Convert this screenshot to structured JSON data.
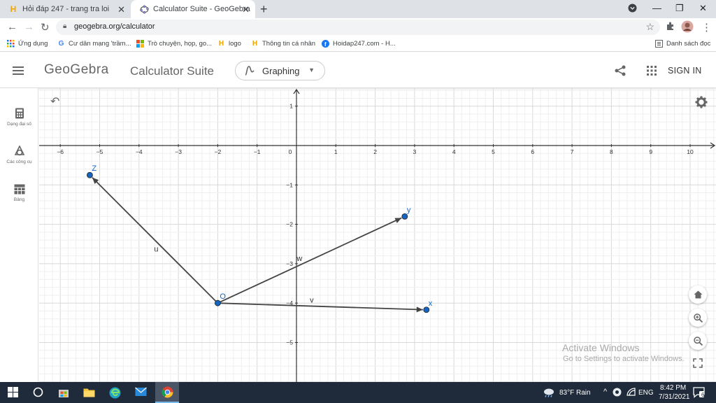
{
  "browser": {
    "tabs": [
      {
        "title": "Hỏi đáp 247 - trang tra loi",
        "icon": "hoidap-favicon"
      },
      {
        "title": "Calculator Suite - GeoGebra",
        "icon": "geogebra-favicon",
        "active": true
      }
    ],
    "url": "geogebra.org/calculator",
    "bookmarks": [
      {
        "label": "Ứng dụng",
        "icon": "apps-grid-icon"
      },
      {
        "label": "Cư dân mạng 'trầm...",
        "icon": "google-icon"
      },
      {
        "label": "Trò chuyện, họp, go...",
        "icon": "microsoft-icon"
      },
      {
        "label": "logo",
        "icon": "hoidap-icon"
      },
      {
        "label": "Thông tin cá nhân",
        "icon": "hoidap-icon"
      },
      {
        "label": "Hoidap247.com - H...",
        "icon": "facebook-icon"
      }
    ],
    "reading_list": "Danh sách đọc"
  },
  "geogebra": {
    "logo": "GeoGebra",
    "suite": "Calculator Suite",
    "app_picker": "Graphing",
    "sign_in": "SIGN IN",
    "left_tools": [
      {
        "label": "Dạng đại số",
        "icon": "calculator-icon"
      },
      {
        "label": "Các công cụ",
        "icon": "tools-icon"
      },
      {
        "label": "Bảng",
        "icon": "table-icon"
      }
    ]
  },
  "graph": {
    "x_ticks": [
      "−6",
      "−5",
      "−4",
      "−3",
      "−2",
      "−1",
      "0",
      "1",
      "2",
      "3",
      "4",
      "5",
      "6",
      "7",
      "8",
      "9",
      "10"
    ],
    "y_ticks": [
      "1",
      "−1",
      "−2",
      "−3",
      "−4",
      "−5"
    ],
    "points": [
      {
        "label": "O",
        "x": -2,
        "y": -4
      },
      {
        "label": "Z",
        "x": -5.25,
        "y": -0.75
      },
      {
        "label": "y",
        "x": 2.75,
        "y": -1.8
      },
      {
        "label": "x",
        "x": 3.3,
        "y": -4.17
      }
    ],
    "vectors": [
      {
        "label": "u",
        "from": "O",
        "to": "Z"
      },
      {
        "label": "w",
        "from": "O",
        "to": "y"
      },
      {
        "label": "v",
        "from": "O",
        "to": "x"
      }
    ],
    "colors": {
      "point": "#1565c0",
      "vector": "#444444",
      "label": "#1565c0"
    }
  },
  "watermark": {
    "line1": "Activate Windows",
    "line2": "Go to Settings to activate Windows."
  },
  "taskbar": {
    "weather": "83°F  Rain",
    "lang": "ENG",
    "time": "8:42 PM",
    "date": "7/31/2021",
    "notifications": "6"
  }
}
